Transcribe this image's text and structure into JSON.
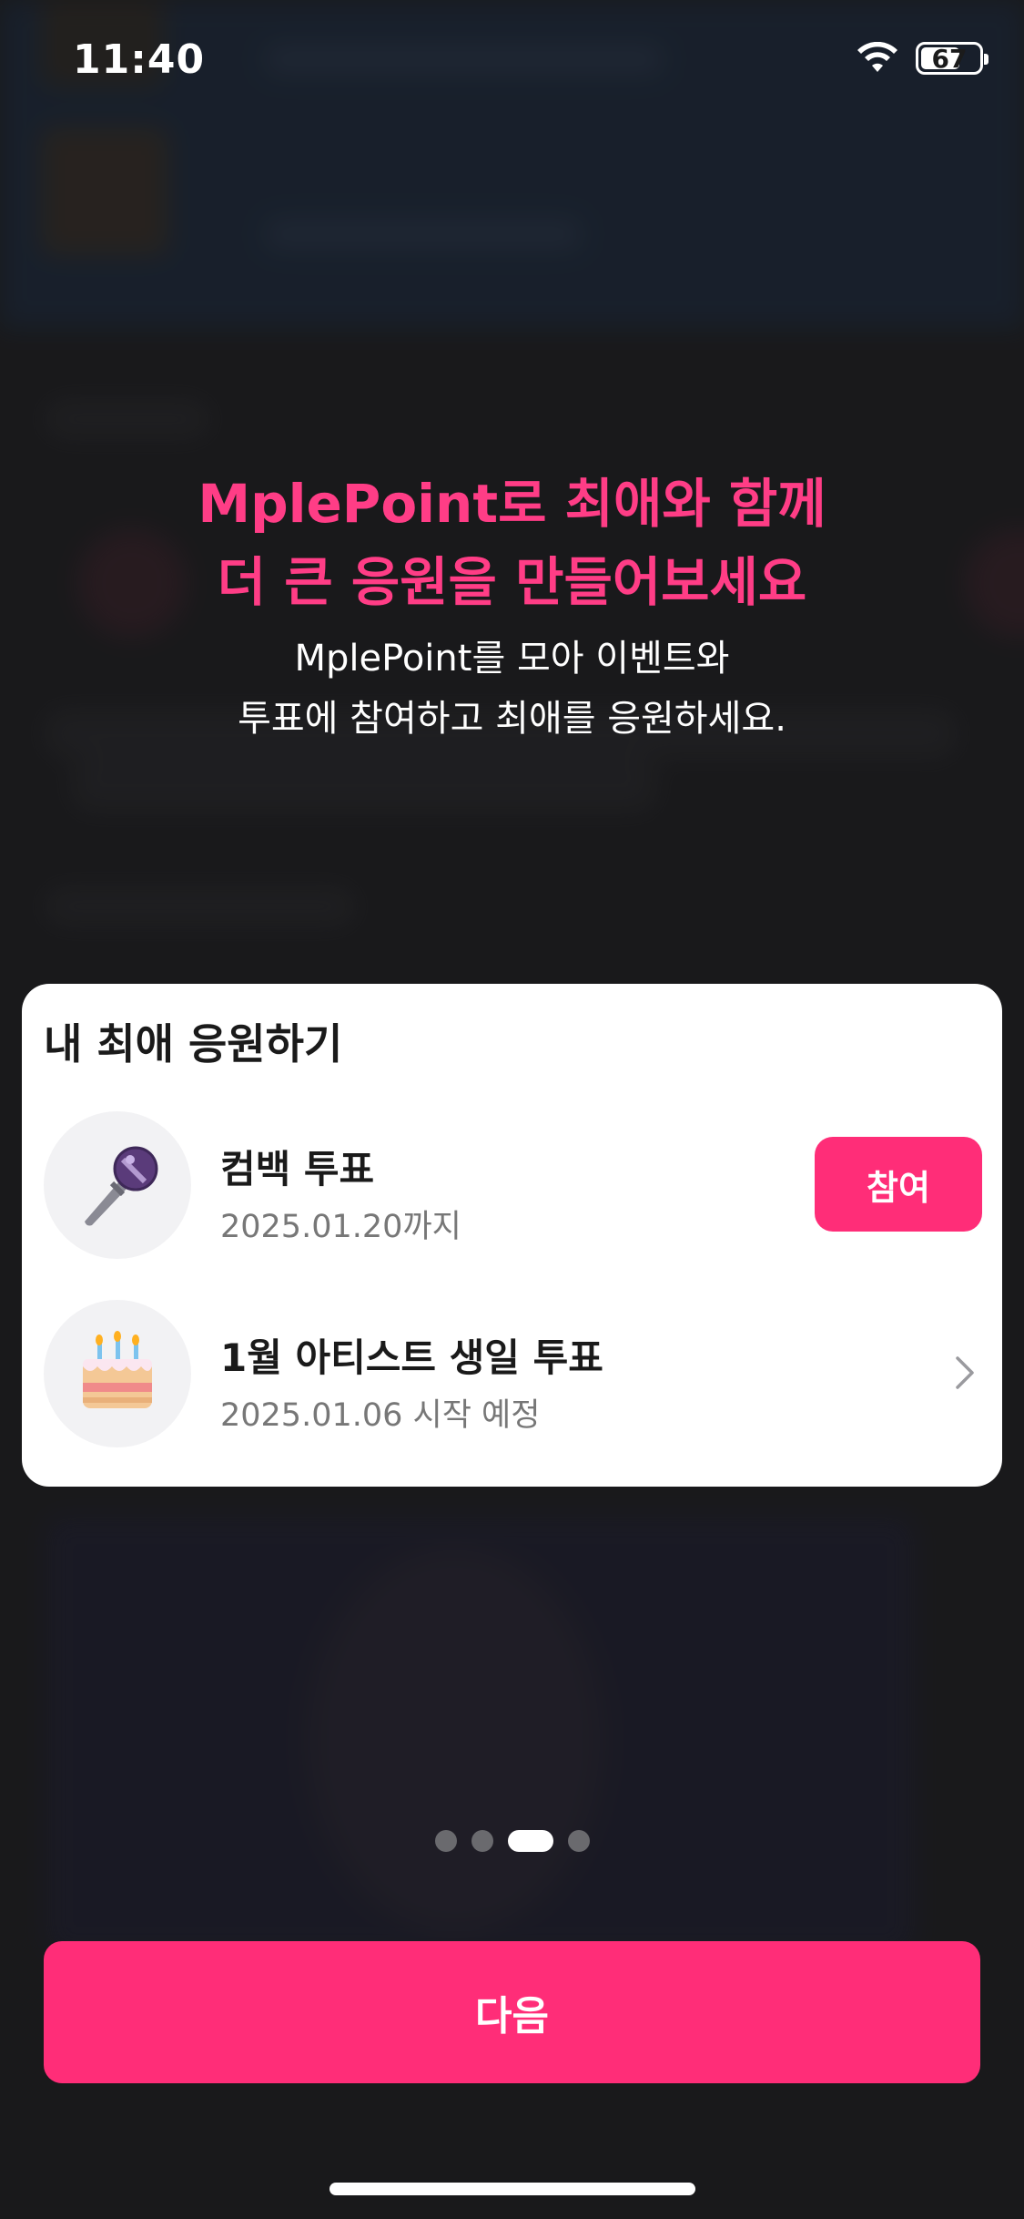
{
  "status_bar": {
    "time": "11:40",
    "battery_level": "67"
  },
  "onboarding": {
    "headline_line1": "MplePoint로 최애와 함께",
    "headline_line2": "더 큰 응원을 만들어보세요",
    "subtext_line1": "MplePoint를 모아 이벤트와",
    "subtext_line2": "투표에 참여하고 최애를 응원하세요."
  },
  "card": {
    "title": "내 최애 응원하기",
    "events": [
      {
        "name": "컴백 투표",
        "date": "2025.01.20까지",
        "icon": "microphone-icon",
        "action_label": "참여"
      },
      {
        "name": "1월 아티스트 생일 투표",
        "date": "2025.01.06 시작 예정",
        "icon": "birthday-cake-icon"
      }
    ]
  },
  "pager": {
    "total": 4,
    "active_index": 2
  },
  "next_button": {
    "label": "다음"
  },
  "colors": {
    "accent": "#ff2d78",
    "headline": "#ff3d86",
    "overlay": "#232325"
  }
}
